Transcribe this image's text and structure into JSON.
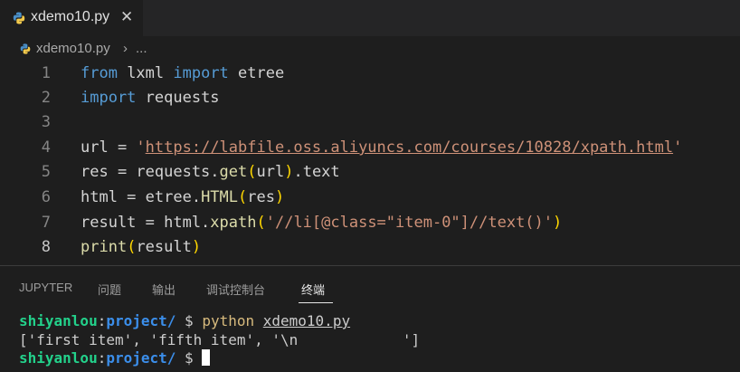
{
  "tab": {
    "filename": "xdemo10.py",
    "close_glyph": "✕"
  },
  "breadcrumb": {
    "file": "xdemo10.py",
    "separator": "›",
    "more": "..."
  },
  "editor": {
    "line_numbers": [
      "1",
      "2",
      "3",
      "4",
      "5",
      "6",
      "7",
      "8"
    ],
    "current_line": "8",
    "lines": {
      "l1": {
        "t0": "from",
        "t1": " lxml ",
        "t2": "import",
        "t3": " etree"
      },
      "l2": {
        "t0": "import",
        "t1": " requests"
      },
      "l4": {
        "t0": "url = ",
        "t1": "'",
        "t2": "https://labfile.oss.aliyuncs.com/courses/10828/xpath.html",
        "t3": "'"
      },
      "l5": {
        "t0": "res = requests.",
        "t1": "get",
        "t2": "(",
        "t3": "url",
        "t4": ")",
        "t5": ".text"
      },
      "l6": {
        "t0": "html = etree.",
        "t1": "HTML",
        "t2": "(",
        "t3": "res",
        "t4": ")"
      },
      "l7": {
        "t0": "result = html.",
        "t1": "xpath",
        "t2": "(",
        "t3": "'//li[@class=\"item-0\"]//text()'",
        "t4": ")"
      },
      "l8": {
        "t0": "print",
        "t1": "(",
        "t2": "result",
        "t3": ")"
      }
    }
  },
  "panel": {
    "tabs": [
      "JUPYTER",
      "问题",
      "输出",
      "调试控制台",
      "终端"
    ],
    "active_tab": "终端"
  },
  "terminal": {
    "line1": {
      "user": "shiyanlou",
      "colon": ":",
      "path": "project/",
      "prompt": " $ ",
      "cmd": "python",
      "space": " ",
      "arg": "xdemo10.py"
    },
    "line2": "['first item', 'fifth item', '\\n            ']",
    "line3": {
      "user": "shiyanlou",
      "colon": ":",
      "path": "project/",
      "prompt": " $ "
    }
  },
  "colors": {
    "keyword": "#569cd6",
    "string": "#ce9178",
    "function": "#dcdcaa",
    "paren": "#ffd700",
    "prompt_user": "#23d18b",
    "prompt_path": "#3b8eea",
    "command": "#d7ba7d"
  }
}
